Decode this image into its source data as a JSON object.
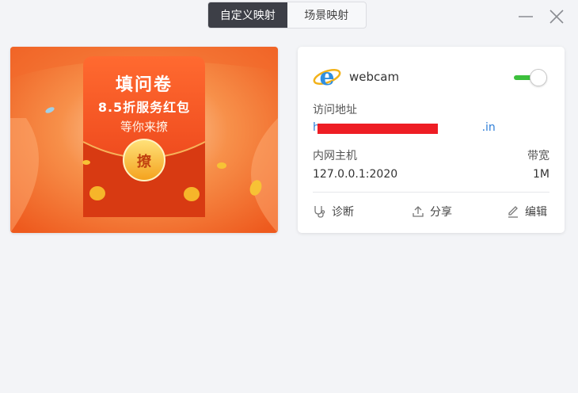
{
  "tabs": [
    {
      "label": "自定义映射",
      "active": true
    },
    {
      "label": "场景映射",
      "active": false
    }
  ],
  "window_controls": {
    "minimize_icon": "minimize-icon",
    "close_icon": "close-icon"
  },
  "banner": {
    "line1": "填问卷",
    "line2": "8.5折服务红包",
    "line3": "等你来撩",
    "coin_label": "撩"
  },
  "card": {
    "name": "webcam",
    "enabled": true,
    "url_label": "访问地址",
    "url_value": "h                                              .in",
    "host_label": "内网主机",
    "host_value": "127.0.0.1:2020",
    "bandwidth_label": "带宽",
    "bandwidth_value": "1M",
    "actions": [
      {
        "label": "诊断",
        "icon": "diagnose-icon"
      },
      {
        "label": "分享",
        "icon": "share-icon"
      },
      {
        "label": "编辑",
        "icon": "edit-icon"
      }
    ]
  },
  "colors": {
    "tab_active_bg": "#3d3f47",
    "toggle_on": "#3cc03c",
    "link": "#2f7fd8",
    "banner_orange": "#f06a2a"
  }
}
